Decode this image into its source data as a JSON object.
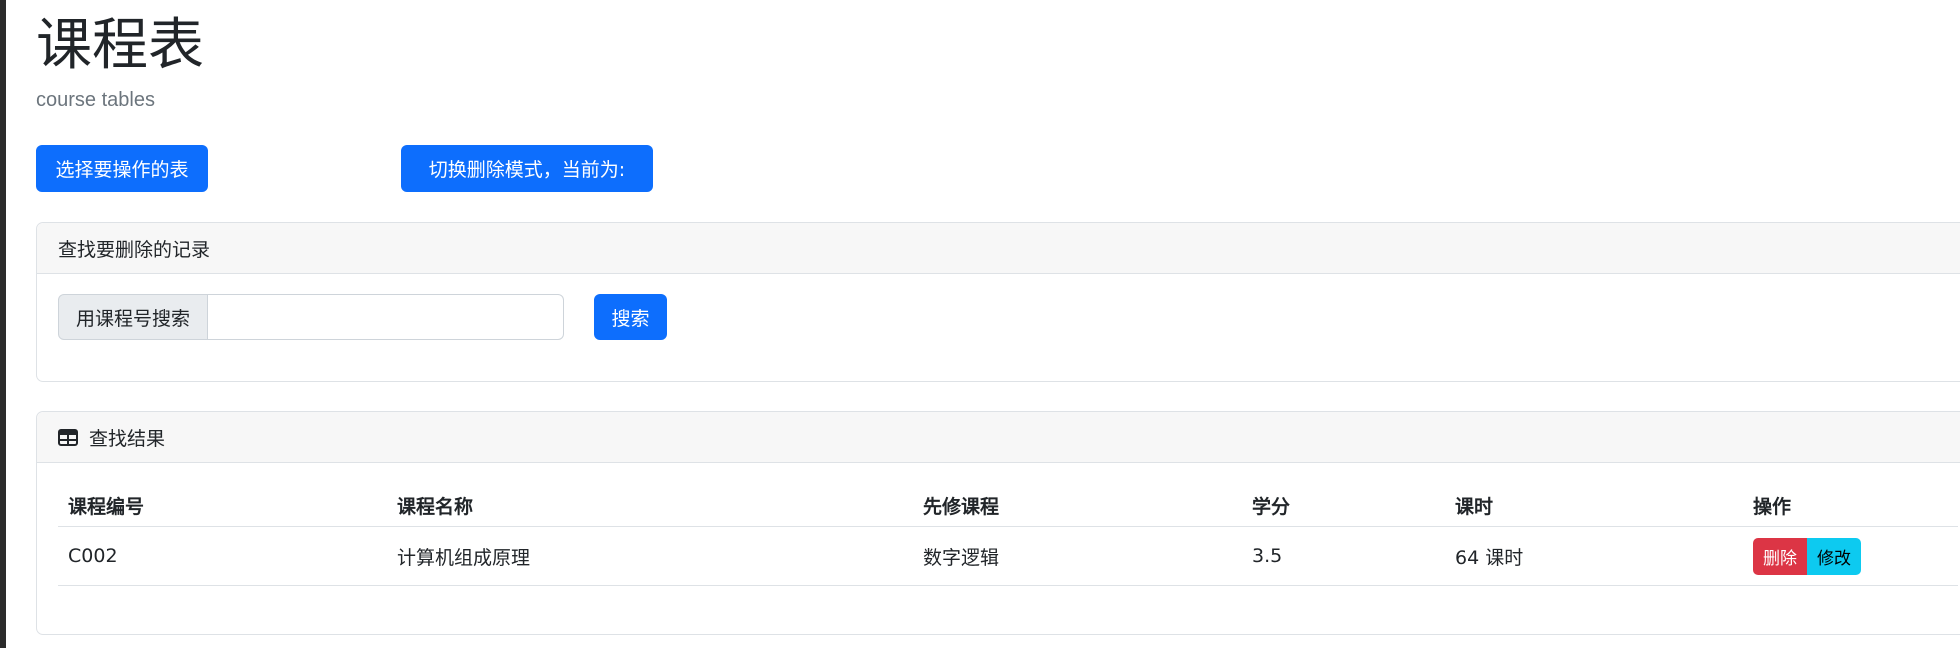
{
  "page": {
    "title": "课程表",
    "subtitle": "course tables"
  },
  "toolbar": {
    "select_table_label": "选择要操作的表",
    "toggle_delete_mode_label": "切换删除模式，当前为:"
  },
  "search_card": {
    "header": "查找要删除的记录",
    "input_addon": "用课程号搜索",
    "input_value": "",
    "input_placeholder": "",
    "search_button": "搜索"
  },
  "results_card": {
    "header": "查找结果",
    "header_icon": "table-icon",
    "columns": [
      "课程编号",
      "课程名称",
      "先修课程",
      "学分",
      "课时",
      "操作"
    ],
    "rows": [
      {
        "course_id": "C002",
        "course_name": "计算机组成原理",
        "prerequisite": "数字逻辑",
        "credit": "3.5",
        "hours": "64 课时",
        "delete_label": "删除",
        "edit_label": "修改"
      }
    ]
  },
  "colors": {
    "primary": "#0d6efd",
    "danger": "#dc3545",
    "info": "#0dcaf0",
    "header_bg": "#f7f7f7"
  }
}
